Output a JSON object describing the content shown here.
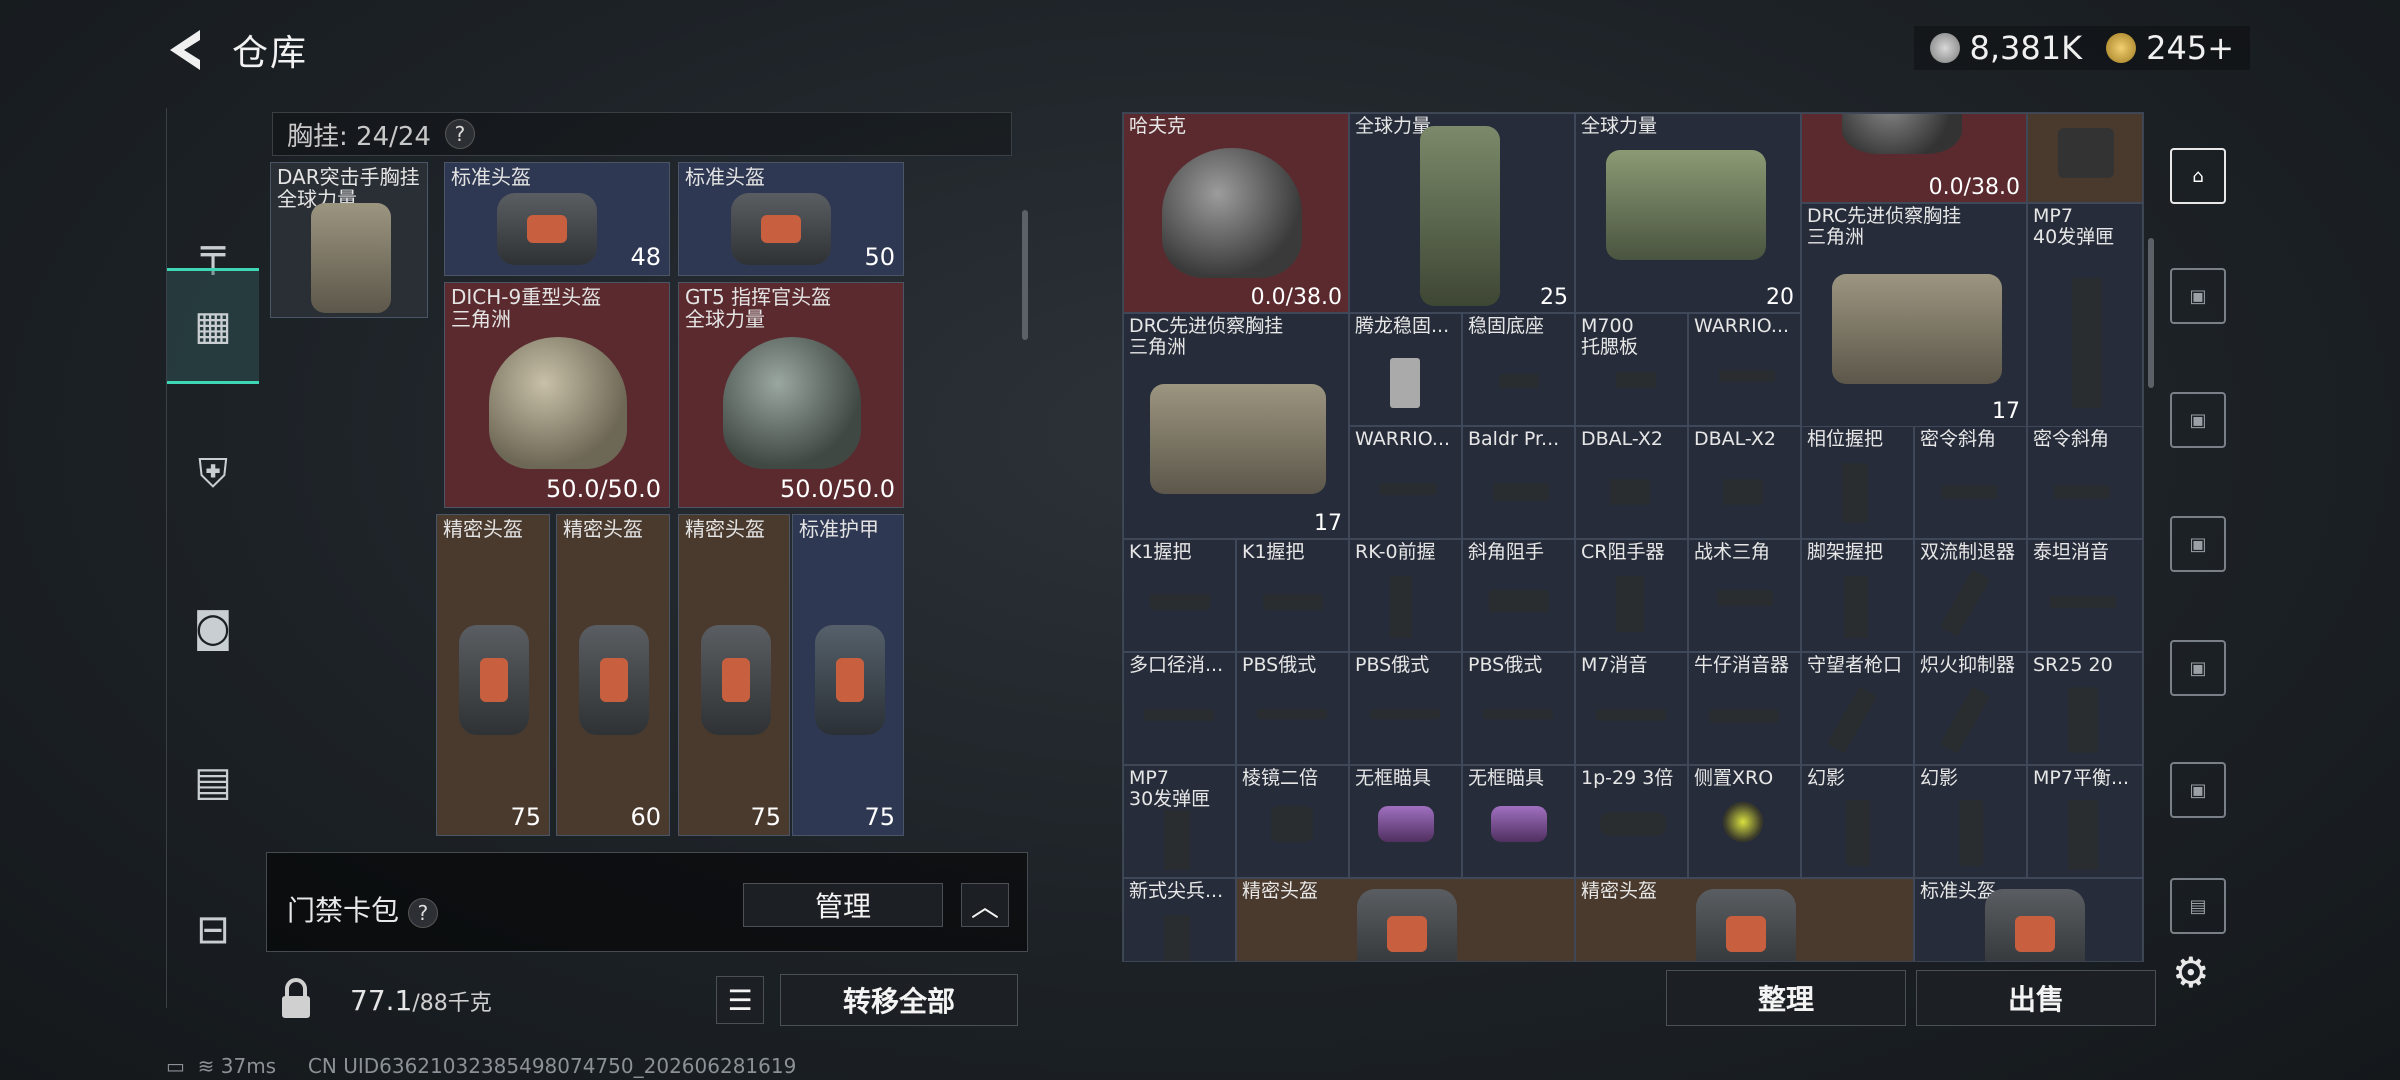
{
  "header": {
    "title": "仓库",
    "currency1": "8,381K",
    "currency2": "245+"
  },
  "left": {
    "chest_label": "胸挂: 24/24",
    "chest_item": "DAR突击手胸挂\n全球力量",
    "cells": [
      {
        "label": "标准头盔",
        "value": "48"
      },
      {
        "label": "标准头盔",
        "value": "50"
      },
      {
        "label": "DICH-9重型头盔\n三角洲",
        "value": "50.0/50.0"
      },
      {
        "label": "GT5 指挥官头盔\n全球力量",
        "value": "50.0/50.0"
      },
      {
        "label": "精密头盔",
        "value": "75"
      },
      {
        "label": "精密头盔",
        "value": "60"
      },
      {
        "label": "精密头盔",
        "value": "75"
      },
      {
        "label": "标准护甲",
        "value": "75"
      }
    ],
    "doorcard_label": "门禁卡包",
    "manage_label": "管理",
    "weight": "77.1",
    "weight_unit": "/88千克",
    "transfer_label": "转移全部"
  },
  "right": {
    "cells": [
      {
        "label": "哈夫克",
        "value": "0.0/38.0"
      },
      {
        "label": "全球力量",
        "value": "25"
      },
      {
        "label": "全球力量",
        "value": "20"
      },
      {
        "label": "",
        "value": "0.0/38.0"
      },
      {
        "label": "DRC先进侦察胸挂\n三角洲",
        "value": "17"
      },
      {
        "label": "MP7\n40发弹匣",
        "value": ""
      },
      {
        "label": "DRC先进侦察胸挂\n三角洲",
        "value": "17"
      },
      {
        "label": "腾龙稳固...",
        "value": ""
      },
      {
        "label": "稳固底座",
        "value": ""
      },
      {
        "label": "M700\n托腮板",
        "value": ""
      },
      {
        "label": "WARRIO...",
        "value": ""
      },
      {
        "label": "WARRIO...",
        "value": ""
      },
      {
        "label": "Baldr Pr...",
        "value": ""
      },
      {
        "label": "DBAL-X2",
        "value": ""
      },
      {
        "label": "DBAL-X2",
        "value": ""
      },
      {
        "label": "相位握把",
        "value": ""
      },
      {
        "label": "密令斜角",
        "value": ""
      },
      {
        "label": "密令斜角",
        "value": ""
      },
      {
        "label": "K1握把",
        "value": ""
      },
      {
        "label": "K1握把",
        "value": ""
      },
      {
        "label": "RK-0前握",
        "value": ""
      },
      {
        "label": "斜角阻手",
        "value": ""
      },
      {
        "label": "CR阻手器",
        "value": ""
      },
      {
        "label": "战术三角",
        "value": ""
      },
      {
        "label": "脚架握把",
        "value": ""
      },
      {
        "label": "双流制退器",
        "value": ""
      },
      {
        "label": "泰坦消音",
        "value": ""
      },
      {
        "label": "多口径消...",
        "value": ""
      },
      {
        "label": "PBS俄式",
        "value": ""
      },
      {
        "label": "PBS俄式",
        "value": ""
      },
      {
        "label": "PBS俄式",
        "value": ""
      },
      {
        "label": "M7消音",
        "value": ""
      },
      {
        "label": "牛仔消音器",
        "value": ""
      },
      {
        "label": "守望者枪口",
        "value": ""
      },
      {
        "label": "炽火抑制器",
        "value": ""
      },
      {
        "label": "SR25 20",
        "value": ""
      },
      {
        "label": "MP7\n30发弹匣",
        "value": ""
      },
      {
        "label": "棱镜二倍",
        "value": ""
      },
      {
        "label": "无框瞄具",
        "value": ""
      },
      {
        "label": "无框瞄具",
        "value": ""
      },
      {
        "label": "1p-29 3倍",
        "value": ""
      },
      {
        "label": "侧置XRO",
        "value": ""
      },
      {
        "label": "幻影",
        "value": ""
      },
      {
        "label": "幻影",
        "value": ""
      },
      {
        "label": "MP7平衡...",
        "value": ""
      },
      {
        "label": "新式尖兵...",
        "value": ""
      },
      {
        "label": "精密头盔",
        "value": ""
      },
      {
        "label": "精密头盔",
        "value": ""
      },
      {
        "label": "标准头盔",
        "value": ""
      }
    ],
    "sort_label": "整理",
    "sell_label": "出售"
  },
  "status": {
    "ping": "37ms",
    "uid": "CN UID63621032385498074750_202606281619"
  },
  "colors": {
    "accent": "#3fd6b5",
    "red_value": "#ff4a4a"
  }
}
